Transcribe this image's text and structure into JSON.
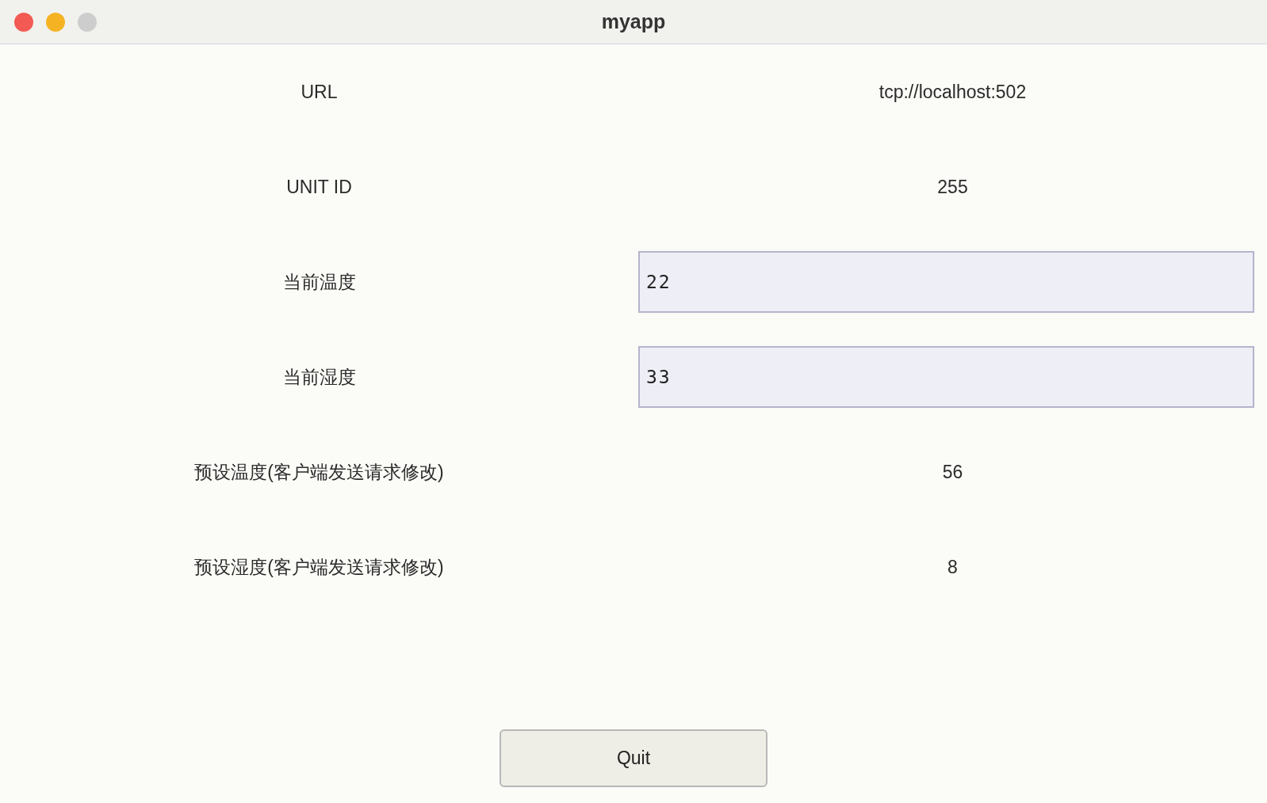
{
  "window": {
    "title": "myapp"
  },
  "rows": [
    {
      "label": "URL",
      "kind": "text",
      "value": "tcp://localhost:502"
    },
    {
      "label": "UNIT ID",
      "kind": "text",
      "value": "255"
    },
    {
      "label": "当前温度",
      "kind": "field",
      "value": "22"
    },
    {
      "label": "当前湿度",
      "kind": "field",
      "value": "33"
    },
    {
      "label": "预设温度(客户端发送请求修改)",
      "kind": "text",
      "value": "56"
    },
    {
      "label": "预设湿度(客户端发送请求修改)",
      "kind": "text",
      "value": "8"
    }
  ],
  "buttons": [
    "Quit"
  ]
}
